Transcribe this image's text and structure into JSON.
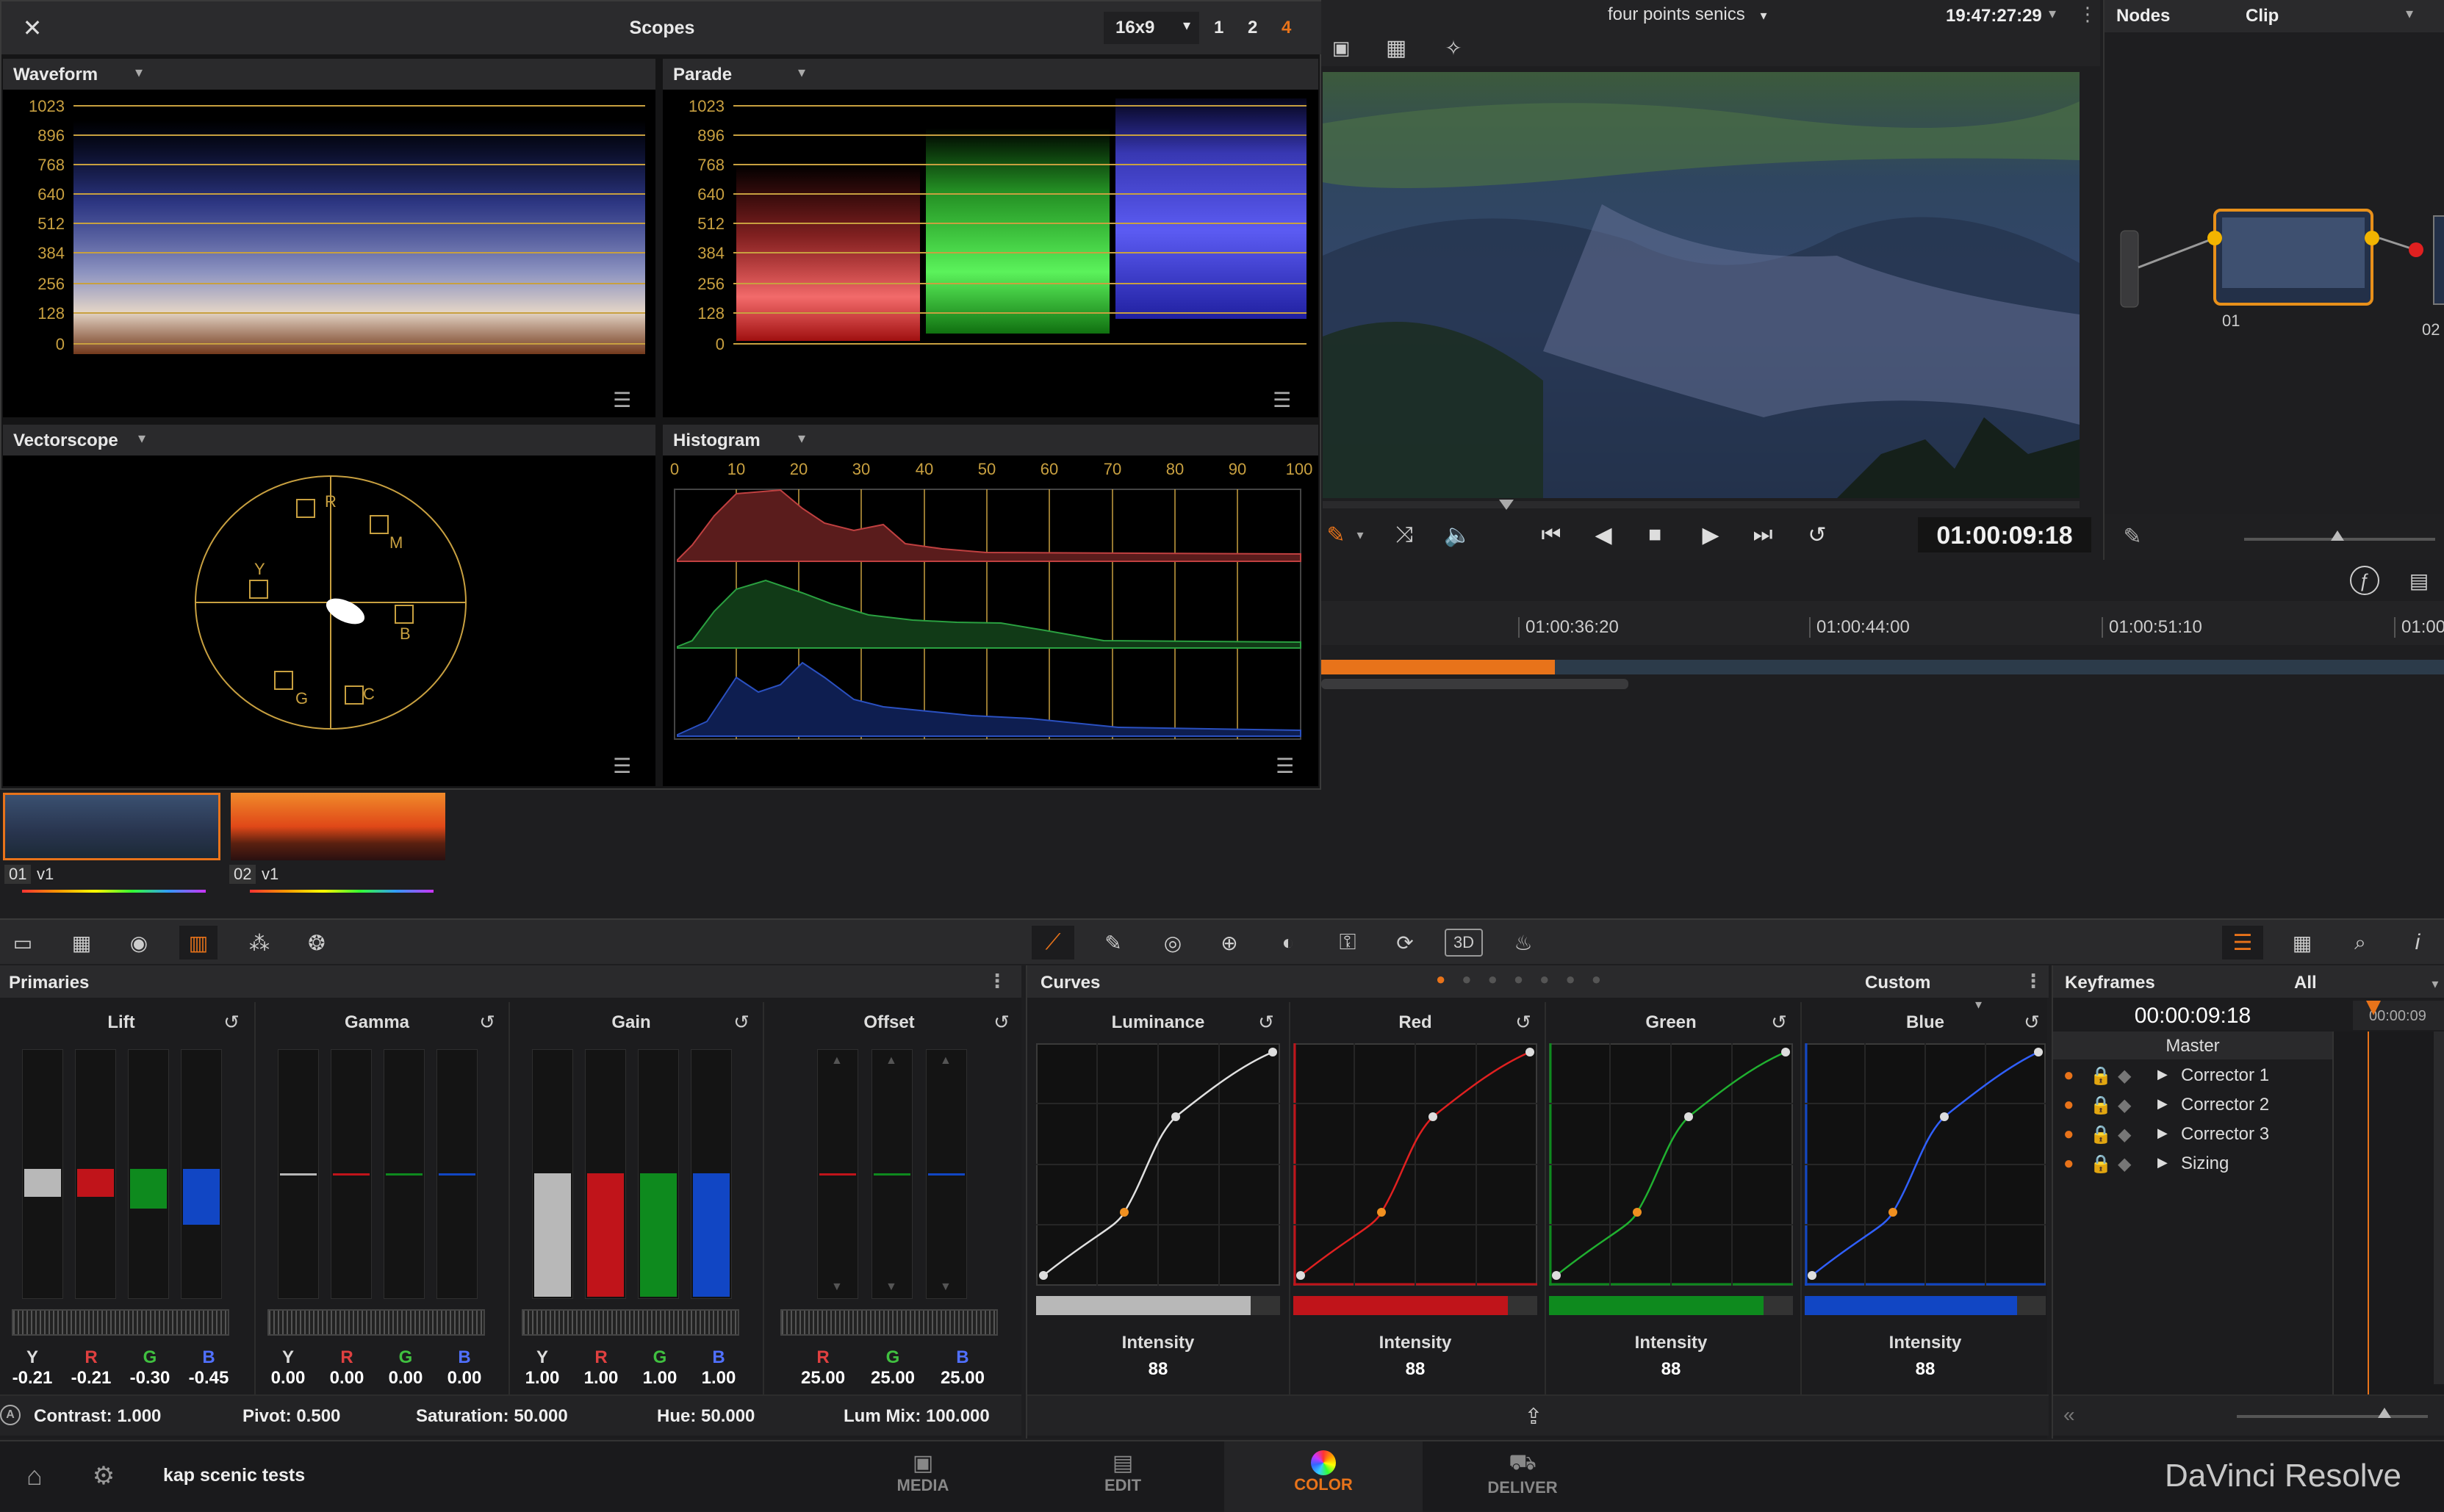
{
  "scopes": {
    "title": "Scopes",
    "aspect": "16x9",
    "layouts": [
      "1",
      "2",
      "4"
    ],
    "waveform": {
      "title": "Waveform",
      "ticks": [
        "1023",
        "896",
        "768",
        "640",
        "512",
        "384",
        "256",
        "128",
        "0"
      ]
    },
    "parade": {
      "title": "Parade",
      "ticks": [
        "1023",
        "896",
        "768",
        "640",
        "512",
        "384",
        "256",
        "128",
        "0"
      ]
    },
    "vectorscope": {
      "title": "Vectorscope",
      "targets": {
        "r": "R",
        "m": "M",
        "y": "Y",
        "b": "B",
        "g": "G",
        "c": "C"
      }
    },
    "histogram": {
      "title": "Histogram",
      "ticks": [
        "0",
        "10",
        "20",
        "30",
        "40",
        "50",
        "60",
        "70",
        "80",
        "90",
        "100"
      ]
    }
  },
  "viewer": {
    "clip_name": "four points senics",
    "timecode_top": "19:47:27:29",
    "timecode": "01:00:09:18"
  },
  "nodes": {
    "tab1": "Nodes",
    "tab2": "Clip",
    "node1": "01",
    "node2": "02"
  },
  "timeline": {
    "ticks": [
      "01:00:36:20",
      "01:00:44:00",
      "01:00:51:10",
      "01:00"
    ]
  },
  "clips": [
    {
      "num": "01",
      "track": "v1"
    },
    {
      "num": "02",
      "track": "v1"
    }
  ],
  "primaries": {
    "title": "Primaries",
    "wheels": [
      {
        "name": "Lift",
        "values": [
          {
            "ch": "Y",
            "v": "-0.21"
          },
          {
            "ch": "R",
            "v": "-0.21"
          },
          {
            "ch": "G",
            "v": "-0.30"
          },
          {
            "ch": "B",
            "v": "-0.45"
          }
        ]
      },
      {
        "name": "Gamma",
        "values": [
          {
            "ch": "Y",
            "v": "0.00"
          },
          {
            "ch": "R",
            "v": "0.00"
          },
          {
            "ch": "G",
            "v": "0.00"
          },
          {
            "ch": "B",
            "v": "0.00"
          }
        ]
      },
      {
        "name": "Gain",
        "values": [
          {
            "ch": "Y",
            "v": "1.00"
          },
          {
            "ch": "R",
            "v": "1.00"
          },
          {
            "ch": "G",
            "v": "1.00"
          },
          {
            "ch": "B",
            "v": "1.00"
          }
        ]
      },
      {
        "name": "Offset",
        "values": [
          {
            "ch": "R",
            "v": "25.00"
          },
          {
            "ch": "G",
            "v": "25.00"
          },
          {
            "ch": "B",
            "v": "25.00"
          }
        ]
      }
    ],
    "bottom": {
      "contrast": "Contrast: 1.000",
      "pivot": "Pivot: 0.500",
      "saturation": "Saturation: 50.000",
      "hue": "Hue: 50.000",
      "lum_mix": "Lum Mix: 100.000"
    }
  },
  "curves": {
    "title": "Curves",
    "mode": "Custom",
    "channels": [
      {
        "name": "Luminance",
        "intensity_label": "Intensity",
        "intensity": "88"
      },
      {
        "name": "Red",
        "intensity_label": "Intensity",
        "intensity": "88"
      },
      {
        "name": "Green",
        "intensity_label": "Intensity",
        "intensity": "88"
      },
      {
        "name": "Blue",
        "intensity_label": "Intensity",
        "intensity": "88"
      }
    ]
  },
  "keyframes": {
    "title": "Keyframes",
    "filter": "All",
    "timecode": "00:00:09:18",
    "ruler_tc": "00:00:09",
    "master": "Master",
    "tracks": [
      "Corrector 1",
      "Corrector 2",
      "Corrector 3",
      "Sizing"
    ]
  },
  "footer": {
    "project": "kap scenic tests",
    "tabs": [
      "MEDIA",
      "EDIT",
      "COLOR",
      "DELIVER"
    ],
    "brand": "DaVinci Resolve"
  },
  "colors": {
    "accent": "#e8731a",
    "red": "#c0141a",
    "green": "#0e8a1e",
    "blue": "#1146c4",
    "gold": "#c8a040"
  }
}
